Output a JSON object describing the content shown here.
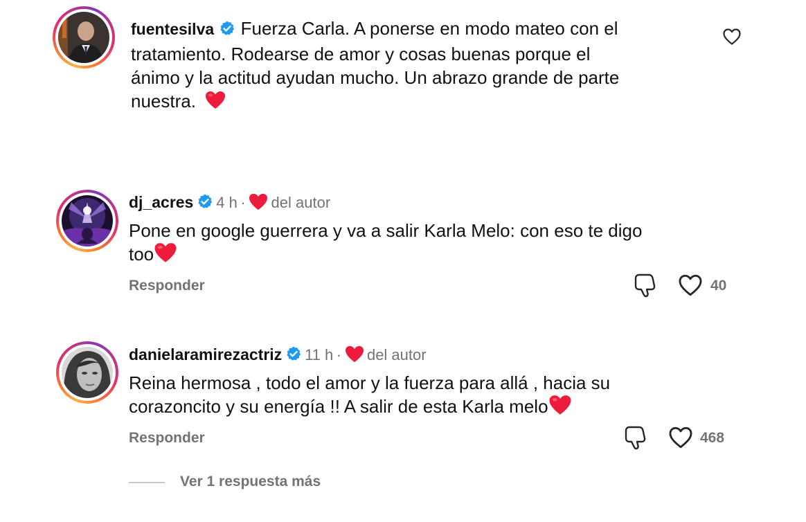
{
  "comments": [
    {
      "username": "fuentesilva",
      "verified": true,
      "text_lines": [
        "Fuerza Carla. A ponerse en modo mateo con el",
        "tratamiento. Rodearse de amor y cosas buenas porque el",
        "ánimo y la actitud ayudan mucho. Un abrazo grande de parte",
        "nuestra."
      ],
      "emoji": "heart-emoji"
    },
    {
      "username": "dj_acres",
      "verified": true,
      "time": "4 h",
      "separator": "·",
      "author_badge": "del autor",
      "text_lines": [
        "Pone en google guerrera y va a salir Karla Melo: con eso te digo",
        "too"
      ],
      "reply_label": "Responder",
      "like_count": "40"
    },
    {
      "username": "danielaramirezactriz",
      "verified": true,
      "time": "11 h",
      "separator": "·",
      "author_badge": "del autor",
      "text_lines": [
        "Reina hermosa , todo el amor y la fuerza para allá , hacia su",
        "corazoncito y su energía !! A salir de esta Karla melo"
      ],
      "reply_label": "Responder",
      "like_count": "468"
    }
  ],
  "view_replies_label": "Ver 1 respuesta más",
  "colors": {
    "heart": "#ed1c3c",
    "verified": "#1d9bf0",
    "muted": "#737373"
  }
}
